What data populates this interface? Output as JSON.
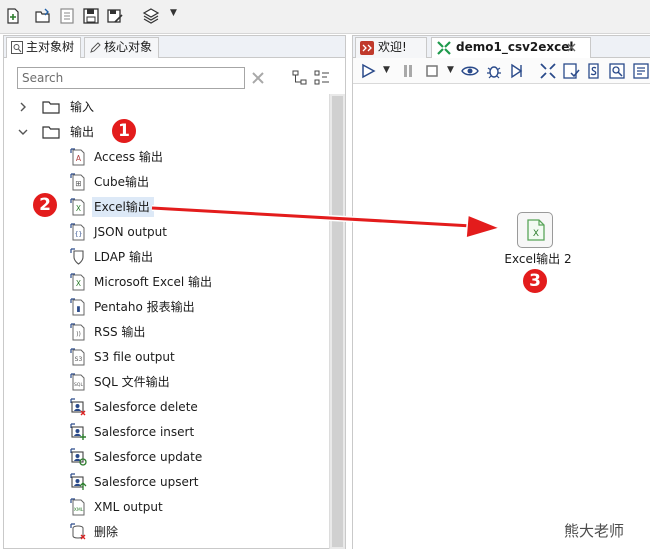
{
  "left_panel": {
    "tabs": [
      {
        "label": "主对象树",
        "icon": "tree-object-icon"
      },
      {
        "label": "核心对象",
        "icon": "pencil-icon"
      }
    ],
    "search": {
      "placeholder": "Search",
      "value": ""
    },
    "tree": {
      "folders": [
        {
          "label": "输入",
          "expanded": false
        },
        {
          "label": "输出",
          "expanded": true
        }
      ],
      "items": [
        {
          "label": "Access 输出",
          "icon": "access-icon",
          "selected": false
        },
        {
          "label": "Cube输出",
          "icon": "cube-icon",
          "selected": false
        },
        {
          "label": "Excel输出",
          "icon": "excel-icon",
          "selected": true
        },
        {
          "label": "JSON output",
          "icon": "json-icon",
          "selected": false
        },
        {
          "label": "LDAP 输出",
          "icon": "ldap-shield-icon",
          "selected": false
        },
        {
          "label": "Microsoft Excel 输出",
          "icon": "excel-icon",
          "selected": false
        },
        {
          "label": "Pentaho 报表输出",
          "icon": "report-chart-icon",
          "selected": false
        },
        {
          "label": "RSS 输出",
          "icon": "rss-icon",
          "selected": false
        },
        {
          "label": "S3 file output",
          "icon": "s3-icon",
          "selected": false
        },
        {
          "label": "SQL 文件输出",
          "icon": "sql-icon",
          "selected": false
        },
        {
          "label": "Salesforce delete",
          "icon": "salesforce-delete-icon",
          "selected": false
        },
        {
          "label": "Salesforce insert",
          "icon": "salesforce-insert-icon",
          "selected": false
        },
        {
          "label": "Salesforce update",
          "icon": "salesforce-update-icon",
          "selected": false
        },
        {
          "label": "Salesforce upsert",
          "icon": "salesforce-upsert-icon",
          "selected": false
        },
        {
          "label": "XML output",
          "icon": "xml-icon",
          "selected": false
        },
        {
          "label": "删除",
          "icon": "database-delete-icon",
          "selected": false
        }
      ]
    }
  },
  "right_panel": {
    "tabs": [
      {
        "label": "欢迎!",
        "icon": "kettle-logo-icon",
        "active": false
      },
      {
        "label": "demo1_csv2excel",
        "icon": "transformation-icon",
        "active": true
      }
    ],
    "canvas": {
      "step": {
        "label": "Excel输出 2",
        "icon": "excel-icon"
      }
    }
  },
  "annotations": {
    "badges": [
      "1",
      "2",
      "3"
    ],
    "arrow_color": "#e31c1c"
  },
  "watermark": "熊大老师",
  "colors": {
    "accent_red": "#e31c1c",
    "selection": "#dde9f7",
    "panel_border": "#c9c9c9"
  }
}
